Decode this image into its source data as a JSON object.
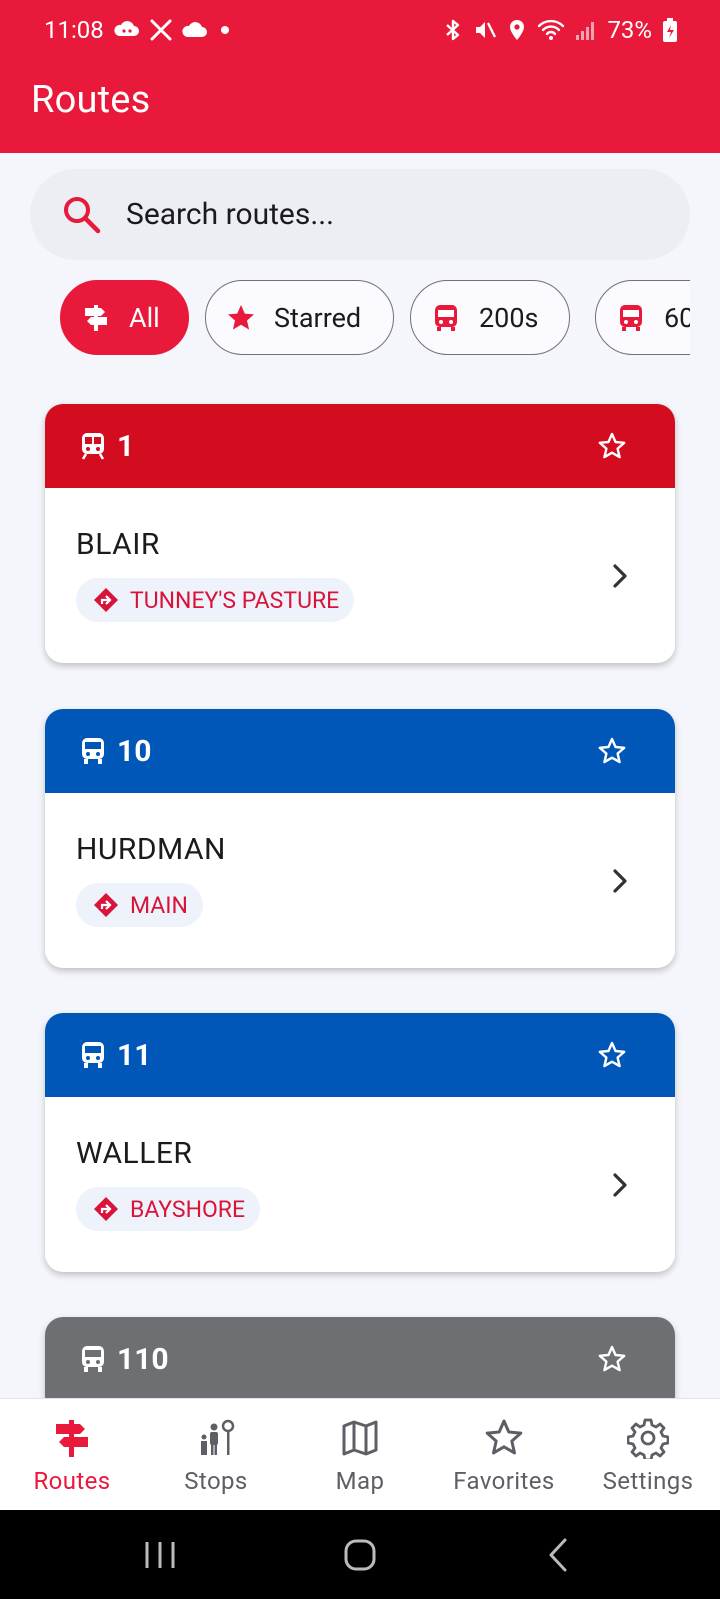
{
  "status_bar": {
    "time": "11:08",
    "battery": "73%"
  },
  "header": {
    "title": "Routes"
  },
  "search": {
    "placeholder": "Search routes..."
  },
  "filters": [
    {
      "label": "All",
      "active": true,
      "icon": "signpost-icon"
    },
    {
      "label": "Starred",
      "active": false,
      "icon": "star-icon"
    },
    {
      "label": "200s",
      "active": false,
      "icon": "bus-icon"
    },
    {
      "label": "60",
      "active": false,
      "icon": "bus-icon"
    }
  ],
  "routes": [
    {
      "number": "1",
      "destination": "BLAIR",
      "direction": "TUNNEY'S PASTURE",
      "color": "#d40c1f",
      "icon": "train-icon"
    },
    {
      "number": "10",
      "destination": "HURDMAN",
      "direction": "MAIN",
      "color": "#0057b7",
      "icon": "bus-icon"
    },
    {
      "number": "11",
      "destination": "WALLER",
      "direction": "BAYSHORE",
      "color": "#0057b7",
      "icon": "bus-icon"
    },
    {
      "number": "110",
      "destination": "",
      "direction": "",
      "color": "#6e6f73",
      "icon": "bus-icon"
    }
  ],
  "bottom_nav": [
    {
      "label": "Routes",
      "active": true,
      "icon": "signpost-icon"
    },
    {
      "label": "Stops",
      "active": false,
      "icon": "people-stop-icon"
    },
    {
      "label": "Map",
      "active": false,
      "icon": "map-icon"
    },
    {
      "label": "Favorites",
      "active": false,
      "icon": "star-outline-icon"
    },
    {
      "label": "Settings",
      "active": false,
      "icon": "gear-icon"
    }
  ],
  "colors": {
    "accent": "#e8193a",
    "route_red": "#d40c1f",
    "route_blue": "#0057b7",
    "route_gray": "#6e6f73"
  }
}
